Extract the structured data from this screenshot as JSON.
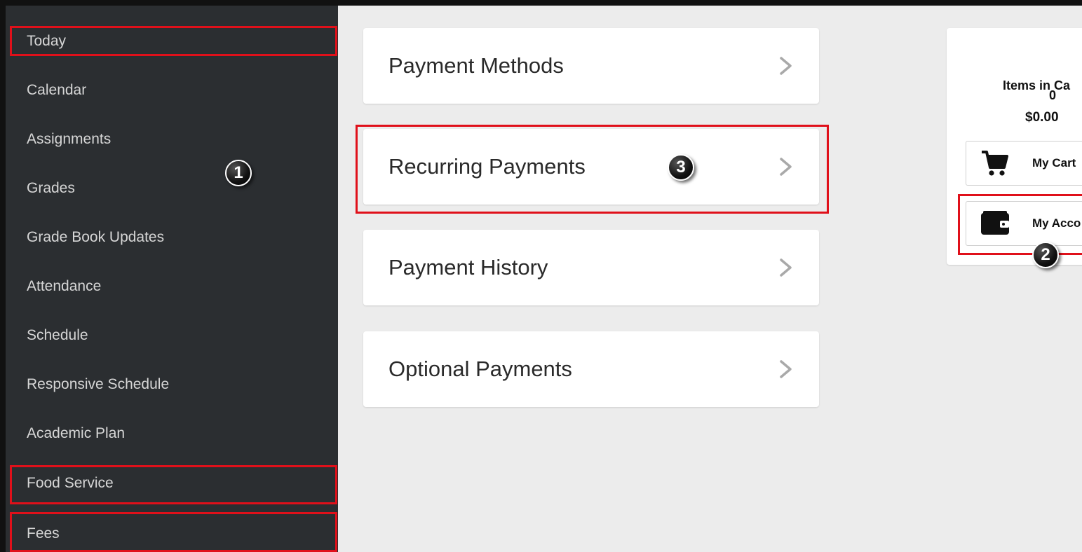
{
  "sidebar": {
    "items": [
      {
        "label": "Today"
      },
      {
        "label": "Calendar"
      },
      {
        "label": "Assignments"
      },
      {
        "label": "Grades"
      },
      {
        "label": "Grade Book Updates"
      },
      {
        "label": "Attendance"
      },
      {
        "label": "Schedule"
      },
      {
        "label": "Responsive Schedule"
      },
      {
        "label": "Academic Plan"
      },
      {
        "label": "Food Service"
      },
      {
        "label": "Fees"
      }
    ]
  },
  "payments": {
    "cards": [
      {
        "label": "Payment Methods"
      },
      {
        "label": "Recurring Payments"
      },
      {
        "label": "Payment History"
      },
      {
        "label": "Optional Payments"
      }
    ]
  },
  "cart": {
    "count": "0",
    "items_label": "Items in Ca",
    "total": "$0.00",
    "my_cart_label": "My Cart",
    "my_account_label": "My Acco"
  },
  "badges": {
    "step1": "1",
    "step2": "2",
    "step3": "3"
  },
  "colors": {
    "sidebar_bg": "#2b2e31",
    "highlight": "#e0101a",
    "page_bg": "#ececec"
  }
}
